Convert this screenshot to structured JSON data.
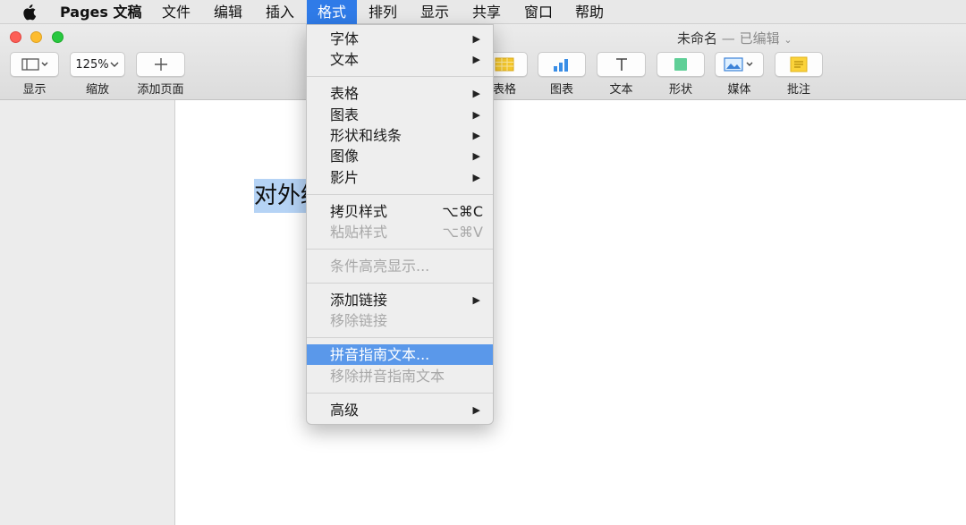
{
  "menubar": {
    "app_name": "Pages 文稿",
    "items": [
      "文件",
      "编辑",
      "插入",
      "格式",
      "排列",
      "显示",
      "共享",
      "窗口",
      "帮助"
    ],
    "active_item": "格式"
  },
  "window": {
    "title": "未命名",
    "title_status": "— 已编辑"
  },
  "toolbar": {
    "view_label": "显示",
    "zoom_value": "125%",
    "zoom_label": "缩放",
    "add_page_label": "添加页面",
    "table_label": "表格",
    "chart_label": "图表",
    "text_label": "文本",
    "shape_label": "形状",
    "media_label": "媒体",
    "comment_label": "批注"
  },
  "document": {
    "selected_text": "对外经"
  },
  "format_menu": {
    "font": "字体",
    "text": "文本",
    "table": "表格",
    "chart": "图表",
    "shapes_lines": "形状和线条",
    "image": "图像",
    "movie": "影片",
    "copy_style": "拷贝样式",
    "copy_style_shortcut": "⌥⌘C",
    "paste_style": "粘贴样式",
    "paste_style_shortcut": "⌥⌘V",
    "conditional_highlight": "条件高亮显示...",
    "add_link": "添加链接",
    "remove_link": "移除链接",
    "pinyin_guide": "拼音指南文本...",
    "remove_pinyin": "移除拼音指南文本",
    "advanced": "高级"
  },
  "colors": {
    "menu_active": "#2f7be8",
    "menu_highlight": "#5a98ea",
    "text_selection": "#b5d3f5",
    "close": "#fc5f57",
    "minimize": "#fdbc2e",
    "zoom": "#28c840"
  },
  "icons": {
    "apple": "apple-logo-icon",
    "submenu": "triangle-right-icon"
  }
}
